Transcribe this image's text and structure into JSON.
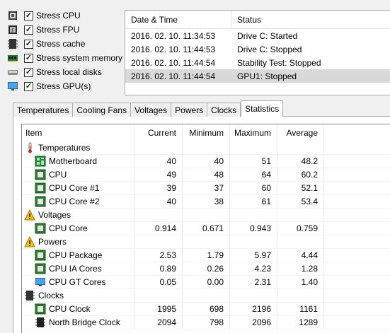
{
  "stress": [
    {
      "label": "Stress CPU",
      "checked": true,
      "icon": "cpu-chip-icon"
    },
    {
      "label": "Stress FPU",
      "checked": true,
      "icon": "fpu-chip-icon"
    },
    {
      "label": "Stress cache",
      "checked": true,
      "icon": "cache-chip-icon"
    },
    {
      "label": "Stress system memory",
      "checked": true,
      "icon": "memory-module-icon"
    },
    {
      "label": "Stress local disks",
      "checked": true,
      "icon": "hard-disk-icon"
    },
    {
      "label": "Stress GPU(s)",
      "checked": true,
      "icon": "monitor-icon"
    }
  ],
  "log": {
    "headers": {
      "datetime": "Date & Time",
      "status": "Status"
    },
    "rows": [
      {
        "datetime": "2016. 02. 10. 11:34:53",
        "status": "Drive C: Started",
        "selected": false
      },
      {
        "datetime": "2016. 02. 10. 11:44:53",
        "status": "Drive C: Stopped",
        "selected": false
      },
      {
        "datetime": "2016. 02. 10. 11:44:54",
        "status": "Stability Test: Stopped",
        "selected": false
      },
      {
        "datetime": "2016. 02. 10. 11:44:54",
        "status": "GPU1: Stopped",
        "selected": true
      }
    ]
  },
  "tabs": [
    {
      "label": "Temperatures",
      "active": false
    },
    {
      "label": "Cooling Fans",
      "active": false
    },
    {
      "label": "Voltages",
      "active": false
    },
    {
      "label": "Powers",
      "active": false
    },
    {
      "label": "Clocks",
      "active": false
    },
    {
      "label": "Statistics",
      "active": true
    }
  ],
  "statistics": {
    "headers": {
      "item": "Item",
      "current": "Current",
      "minimum": "Minimum",
      "maximum": "Maximum",
      "average": "Average"
    },
    "categories": [
      {
        "label": "Temperatures",
        "icon": "thermometer-icon",
        "items": [
          {
            "label": "Motherboard",
            "icon": "motherboard-icon",
            "current": "40",
            "minimum": "40",
            "maximum": "51",
            "average": "48.2"
          },
          {
            "label": "CPU",
            "icon": "cpu-icon",
            "current": "49",
            "minimum": "48",
            "maximum": "64",
            "average": "60.2"
          },
          {
            "label": "CPU Core #1",
            "icon": "cpu-icon",
            "current": "39",
            "minimum": "37",
            "maximum": "60",
            "average": "52.1"
          },
          {
            "label": "CPU Core #2",
            "icon": "cpu-icon",
            "current": "40",
            "minimum": "38",
            "maximum": "61",
            "average": "53.4"
          }
        ]
      },
      {
        "label": "Voltages",
        "icon": "voltage-warning-icon",
        "items": [
          {
            "label": "CPU Core",
            "icon": "cpu-icon",
            "current": "0.914",
            "minimum": "0.671",
            "maximum": "0.943",
            "average": "0.759"
          }
        ]
      },
      {
        "label": "Powers",
        "icon": "power-warning-icon",
        "items": [
          {
            "label": "CPU Package",
            "icon": "cpu-icon",
            "current": "2.53",
            "minimum": "1.79",
            "maximum": "5.97",
            "average": "4.44"
          },
          {
            "label": "CPU IA Cores",
            "icon": "cpu-icon",
            "current": "0.89",
            "minimum": "0.26",
            "maximum": "4.23",
            "average": "1.28"
          },
          {
            "label": "CPU GT Cores",
            "icon": "monitor-icon",
            "current": "0.05",
            "minimum": "0.00",
            "maximum": "2.31",
            "average": "1.40"
          }
        ]
      },
      {
        "label": "Clocks",
        "icon": "clock-chip-icon",
        "items": [
          {
            "label": "CPU Clock",
            "icon": "cpu-icon",
            "current": "1995",
            "minimum": "698",
            "maximum": "2196",
            "average": "1161"
          },
          {
            "label": "North Bridge Clock",
            "icon": "chip-icon",
            "current": "2094",
            "minimum": "798",
            "maximum": "2096",
            "average": "1289"
          }
        ]
      }
    ]
  },
  "colors": {
    "selected_row": "#d9d9d9",
    "panel_bg": "#ffffff",
    "window_bg": "#f0f0f0"
  }
}
